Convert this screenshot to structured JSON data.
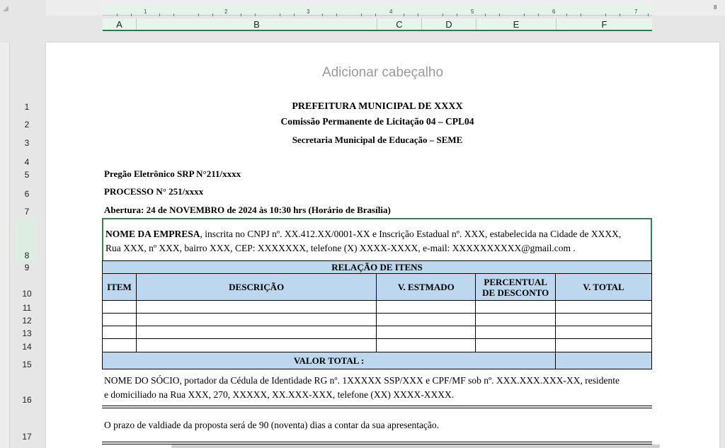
{
  "ruler": {
    "numbers": [
      "1",
      "2",
      "3",
      "4",
      "5",
      "6",
      "7",
      "8"
    ]
  },
  "columns": [
    "A",
    "B",
    "C",
    "D",
    "E",
    "F"
  ],
  "rows": [
    "1",
    "2",
    "3",
    "4",
    "5",
    "6",
    "7",
    "8",
    "9",
    "10",
    "11",
    "12",
    "13",
    "14",
    "15",
    "16",
    "17"
  ],
  "header_placeholder": "Adicionar cabeçalho",
  "document": {
    "title": "PREFEITURA MUNICIPAL DE XXXX",
    "commission": "Comissão Permanente de Licitação 04 – CPL04",
    "secretariat": "Secretaria Municipal de Educação – SEME",
    "pregao": "Pregão Eletrônico SRP N°211/xxxx",
    "processo": "PROCESSO  N° 251/xxxx",
    "abertura": "Abertura: 24 de NOVEMBRO de 2024 às 10:30 hrs (Horário de Brasília)",
    "company_name": "NOME DA EMPRESA",
    "company_text_line1": ", inscrita no CNPJ nº. XX.412.XX/0001-XX e Inscrição Estadual nº. XXX, estabelecida na Cidade de XXXX,",
    "company_text_line2": "Rua XXX, nº XXX, bairro XXX, CEP:  XXXXXXX, telefone (X) XXXX-XXXX, e-mail: XXXXXXXXXX@gmail.com .",
    "table": {
      "title": "RELAÇÃO DE ITENS",
      "headers": {
        "item": "ITEM",
        "descricao": "DESCRIÇÃO",
        "v_estimado": "V. ESTMADO",
        "percentual_line1": "PERCENTUAL",
        "percentual_line2": "DE DESCONTO",
        "v_total": "V. TOTAL"
      },
      "total_label": "VALOR TOTAL :"
    },
    "partner_line1": "NOME DO SÓCIO, portador da Cédula de Identidade RG nº. 1XXXXX SSP/XXX e CPF/MF sob nº. XXX.XXX.XXX-XX, residente",
    "partner_line2": "e domiciliado na Rua XXX, 270, XXXXX, XX.XXX-XXX, telefone (XX) XXXX-XXXX.",
    "validity": "O prazo de valdiade da proposta será de 90 (noventa) dias a contar da sua apresentação."
  },
  "colors": {
    "selection_border": "#3a7f55",
    "table_header_fill": "#bdd7ee",
    "header_highlight": "#e8f5ec"
  }
}
